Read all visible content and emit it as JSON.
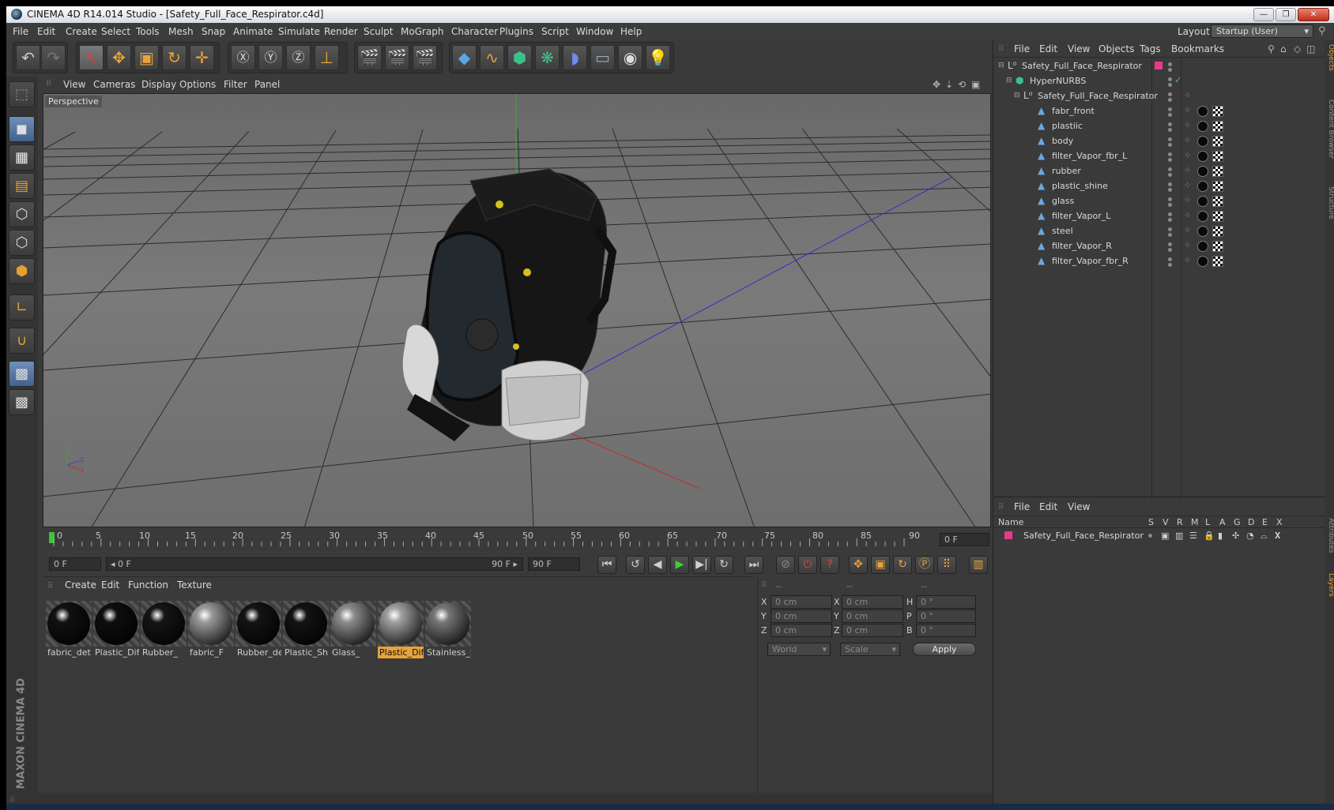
{
  "window": {
    "title": "CINEMA 4D R14.014 Studio - [Safety_Full_Face_Respirator.c4d]",
    "minimize_icon": "minimize-icon",
    "restore_icon": "restore-icon",
    "close_icon": "close-icon"
  },
  "menubar": {
    "items": [
      "File",
      "Edit",
      "Create",
      "Select",
      "Tools",
      "Mesh",
      "Snap",
      "Animate",
      "Simulate",
      "Render",
      "Sculpt",
      "MoGraph",
      "Character",
      "Plugins",
      "Script",
      "Window",
      "Help"
    ],
    "layout_label": "Layout:",
    "layout_value": "Startup (User)"
  },
  "viewport": {
    "menu": [
      "View",
      "Cameras",
      "Display",
      "Options",
      "Filter",
      "Panel"
    ],
    "label": "Perspective"
  },
  "timeline": {
    "ticks": [
      "0",
      "5",
      "10",
      "15",
      "20",
      "25",
      "30",
      "35",
      "40",
      "45",
      "50",
      "55",
      "60",
      "65",
      "70",
      "75",
      "80",
      "85",
      "90"
    ],
    "frame_field": "0 F"
  },
  "transport": {
    "start": "0 F",
    "slider_start": "0 F",
    "slider_end": "90 F",
    "end": "90 F"
  },
  "materials": {
    "menu": [
      "Create",
      "Edit",
      "Function",
      "Texture"
    ],
    "items": [
      {
        "name": "fabric_det",
        "color": "#111111"
      },
      {
        "name": "Plastic_Diff",
        "color": "#0e0e0e"
      },
      {
        "name": "Rubber_",
        "color": "#151515"
      },
      {
        "name": "fabric_F",
        "color": "#9a9a9a"
      },
      {
        "name": "Rubber_de",
        "color": "#141414"
      },
      {
        "name": "Plastic_Shi",
        "color": "#131313"
      },
      {
        "name": "Glass_",
        "color": "#8c8c8c"
      },
      {
        "name": "Plastic_Diff",
        "color": "#a0a0a0",
        "selected": true
      },
      {
        "name": "Stainless_S",
        "color": "#777777"
      }
    ]
  },
  "coordinates": {
    "headers": [
      "--",
      "--",
      "--"
    ],
    "rows": [
      {
        "a": "X",
        "av": "0 cm",
        "b": "X",
        "bv": "0 cm",
        "c": "H",
        "cv": "0 °"
      },
      {
        "a": "Y",
        "av": "0 cm",
        "b": "Y",
        "bv": "0 cm",
        "c": "P",
        "cv": "0 °"
      },
      {
        "a": "Z",
        "av": "0 cm",
        "b": "Z",
        "bv": "0 cm",
        "c": "B",
        "cv": "0 °"
      }
    ],
    "space": "World",
    "mode": "Scale",
    "apply": "Apply"
  },
  "objects": {
    "menu": [
      "File",
      "Edit",
      "View",
      "Objects",
      "Tags",
      "Bookmarks"
    ],
    "tree": [
      {
        "name": "Safety_Full_Face_Respirator",
        "level": 0
      },
      {
        "name": "HyperNURBS",
        "level": 1
      },
      {
        "name": "Safety_Full_Face_Respirator",
        "level": 2
      },
      {
        "name": "fabr_front",
        "level": 3
      },
      {
        "name": "plastiic",
        "level": 3
      },
      {
        "name": "body",
        "level": 3
      },
      {
        "name": "filter_Vapor_fbr_L",
        "level": 3
      },
      {
        "name": "rubber",
        "level": 3
      },
      {
        "name": "plastic_shine",
        "level": 3
      },
      {
        "name": "glass",
        "level": 3
      },
      {
        "name": "filter_Vapor_L",
        "level": 3
      },
      {
        "name": "steel",
        "level": 3
      },
      {
        "name": "filter_Vapor_R",
        "level": 3
      },
      {
        "name": "filter_Vapor_fbr_R",
        "level": 3
      }
    ]
  },
  "layers": {
    "menu": [
      "File",
      "Edit",
      "View"
    ],
    "columns": [
      "Name",
      "S",
      "V",
      "R",
      "M",
      "L",
      "A",
      "G",
      "D",
      "E",
      "X"
    ],
    "row": "Safety_Full_Face_Respirator"
  },
  "side_tabs": [
    "Objects",
    "Content Browser",
    "Structure",
    "Attributes",
    "Layers"
  ],
  "brand": "MAXON CINEMA 4D"
}
